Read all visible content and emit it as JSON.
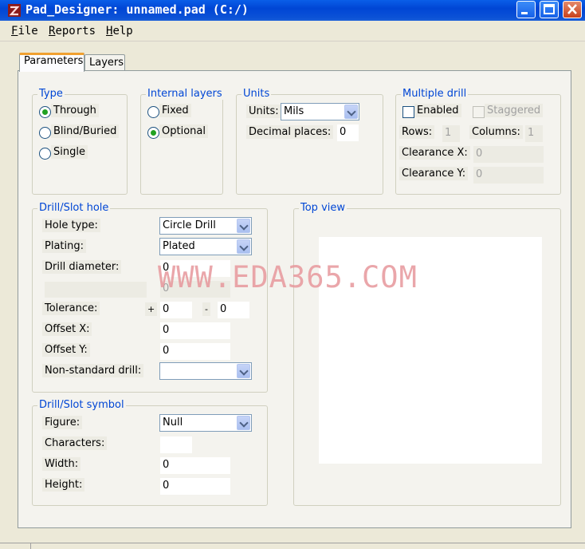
{
  "window": {
    "title": "Pad_Designer: unnamed.pad (C:/)"
  },
  "menu": {
    "file": "File",
    "reports": "Reports",
    "help": "Help"
  },
  "tabs": {
    "parameters": "Parameters",
    "layers": "Layers",
    "active": "Parameters"
  },
  "type_group": {
    "legend": "Type",
    "through": "Through",
    "blind_buried": "Blind/Buried",
    "single": "Single",
    "selected": "Through"
  },
  "internal_layers": {
    "legend": "Internal layers",
    "fixed": "Fixed",
    "optional": "Optional",
    "selected": "Optional"
  },
  "units": {
    "legend": "Units",
    "units_label": "Units:",
    "units_value": "Mils",
    "decimal_label": "Decimal places:",
    "decimal_value": "0"
  },
  "multiple_drill": {
    "legend": "Multiple drill",
    "enabled": "Enabled",
    "staggered": "Staggered",
    "rows_label": "Rows:",
    "rows_value": "1",
    "columns_label": "Columns:",
    "columns_value": "1",
    "clearance_x_label": "Clearance X:",
    "clearance_x_value": "0",
    "clearance_y_label": "Clearance Y:",
    "clearance_y_value": "0",
    "enabled_checked": false
  },
  "drill_slot_hole": {
    "legend": "Drill/Slot hole",
    "hole_type_label": "Hole type:",
    "hole_type_value": "Circle Drill",
    "plating_label": "Plating:",
    "plating_value": "Plated",
    "drill_diameter_label": "Drill diameter:",
    "drill_diameter_value": "0",
    "slot_value": "0",
    "tolerance_label": "Tolerance:",
    "plus": "+",
    "minus": "-",
    "tolerance_plus": "0",
    "tolerance_minus": "0",
    "offset_x_label": "Offset X:",
    "offset_x_value": "0",
    "offset_y_label": "Offset Y:",
    "offset_y_value": "0",
    "nonstandard_label": "Non-standard drill:",
    "nonstandard_value": ""
  },
  "drill_slot_symbol": {
    "legend": "Drill/Slot symbol",
    "figure_label": "Figure:",
    "figure_value": "Null",
    "characters_label": "Characters:",
    "characters_value": "",
    "width_label": "Width:",
    "width_value": "0",
    "height_label": "Height:",
    "height_value": "0"
  },
  "top_view": {
    "legend": "Top view"
  },
  "watermark": "WWW.EDA365.COM",
  "colors": {
    "title_bar": "#0054e3",
    "legend_text": "#0046d5",
    "radio_dot": "#21a121",
    "panel_bg": "#f4f3ee",
    "window_bg": "#ece9d8",
    "watermark": "#e6969b"
  }
}
